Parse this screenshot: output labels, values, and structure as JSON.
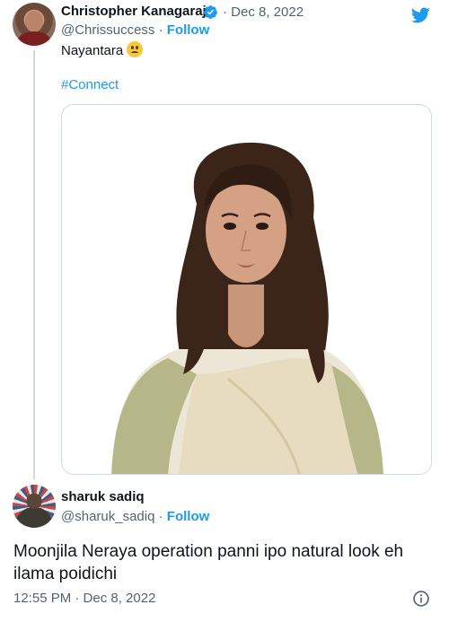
{
  "parent_tweet": {
    "author_name": "Christopher Kanagaraj",
    "date": "· Dec 8, 2022",
    "handle": "@Chrissuccess",
    "separator": "·",
    "follow_label": "Follow",
    "text": "Nayantara",
    "hashtag": "#Connect"
  },
  "reply_tweet": {
    "author_name": "sharuk sadiq",
    "handle": "@sharuk_sadiq",
    "separator": "·",
    "follow_label": "Follow",
    "text": "Moonjila Neraya operation panni ipo natural look eh ilama poidichi",
    "timestamp": "12:55 PM · Dec 8, 2022"
  },
  "colors": {
    "accent": "#1d9bf0",
    "text_primary": "#0f1419",
    "text_secondary": "#536471",
    "border": "#cfd9de"
  },
  "icons": {
    "verified": "verified-badge-icon",
    "brand": "twitter-bird-icon",
    "emoji": "frowning-face-emoji",
    "info": "info-icon"
  }
}
